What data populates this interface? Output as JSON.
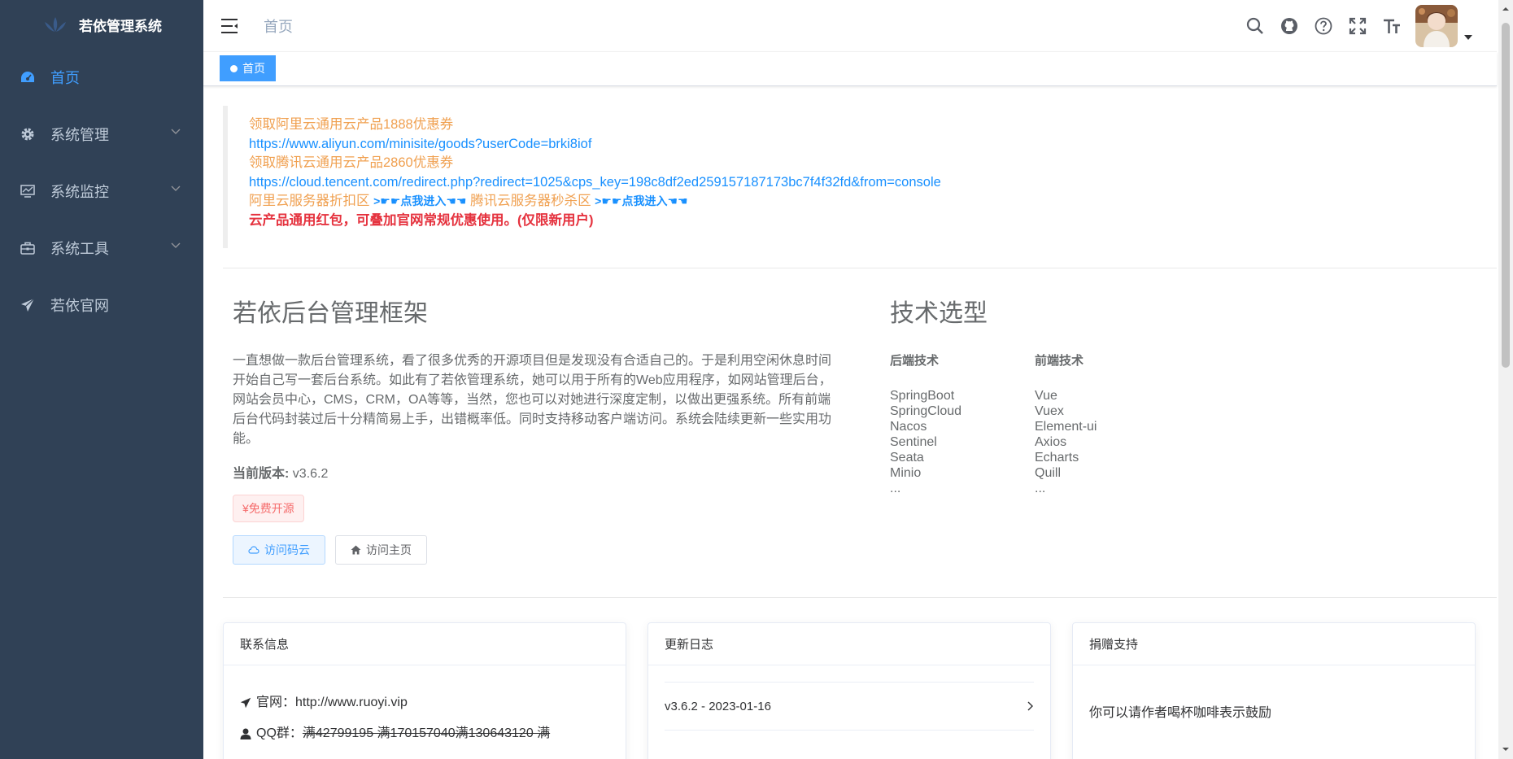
{
  "app": {
    "logo_text": "若依管理系统"
  },
  "sidebar": {
    "items": [
      {
        "label": "首页",
        "icon": "dashboard-icon",
        "active": true
      },
      {
        "label": "系统管理",
        "icon": "gear-icon",
        "has_arrow": true
      },
      {
        "label": "系统监控",
        "icon": "monitor-icon",
        "has_arrow": true
      },
      {
        "label": "系统工具",
        "icon": "toolbox-icon",
        "has_arrow": true
      },
      {
        "label": "若依官网",
        "icon": "paper-plane-icon"
      }
    ]
  },
  "navbar": {
    "breadcrumb": "首页",
    "icons": [
      "search-icon",
      "github-icon",
      "question-icon",
      "fullscreen-icon",
      "font-size-icon"
    ]
  },
  "tags": {
    "active": "首页"
  },
  "notice": {
    "line1": "领取阿里云通用云产品1888优惠券",
    "line2": "https://www.aliyun.com/minisite/goods?userCode=brki8iof",
    "line3": "领取腾讯云通用云产品2860优惠券",
    "line4": "https://cloud.tencent.com/redirect.php?redirect=1025&cps_key=198c8df2ed259157187173bc7f4f32fd&from=console",
    "aliyun_zone": "阿里云服务器折扣区",
    "enter1": ">☛☛点我进入☚☚",
    "tencent_zone": "腾讯云服务器秒杀区",
    "enter2": ">☛☛点我进入☚☚",
    "red_text": "云产品通用红包，可叠加官网常规优惠使用。(仅限新用户)"
  },
  "intro": {
    "title": "若依后台管理框架",
    "desc": "一直想做一款后台管理系统，看了很多优秀的开源项目但是发现没有合适自己的。于是利用空闲休息时间开始自己写一套后台系统。如此有了若依管理系统，她可以用于所有的Web应用程序，如网站管理后台，网站会员中心，CMS，CRM，OA等等，当然，您也可以对她进行深度定制，以做出更强系统。所有前端后台代码封装过后十分精简易上手，出错概率低。同时支持移动客户端访问。系统会陆续更新一些实用功能。",
    "version_label": "当前版本:",
    "version_value": "v3.6.2",
    "free_tag": "¥免费开源",
    "btn_gitee": "访问码云",
    "btn_home": "访问主页"
  },
  "tech": {
    "title": "技术选型",
    "backend_title": "后端技术",
    "backend": [
      "SpringBoot",
      "SpringCloud",
      "Nacos",
      "Sentinel",
      "Seata",
      "Minio",
      "..."
    ],
    "frontend_title": "前端技术",
    "frontend": [
      "Vue",
      "Vuex",
      "Element-ui",
      "Axios",
      "Echarts",
      "Quill",
      "..."
    ]
  },
  "cards": {
    "contact": {
      "title": "联系信息",
      "website_label": "官网：",
      "website": "http://www.ruoyi.vip",
      "qq_label": "QQ群：",
      "qq_groups": "满42799195 满170157040满130643120 满"
    },
    "changelog": {
      "title": "更新日志",
      "item": "v3.6.2 - 2023-01-16"
    },
    "donate": {
      "title": "捐赠支持",
      "text": "你可以请作者喝杯咖啡表示鼓励"
    }
  },
  "colors": {
    "sidebar_bg": "#304156",
    "accent": "#409eff",
    "link": "#1890ff",
    "orange": "#f0a050",
    "red": "#e5323e"
  }
}
